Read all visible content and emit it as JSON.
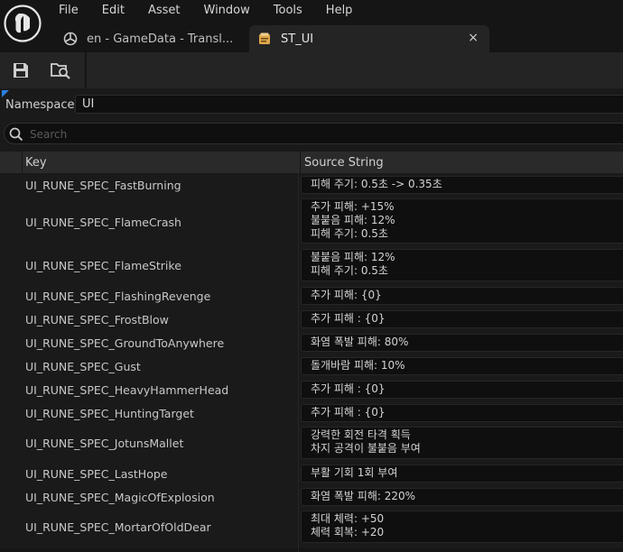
{
  "menu": [
    "File",
    "Edit",
    "Asset",
    "Window",
    "Tools",
    "Help"
  ],
  "tabs": [
    {
      "label": "en - GameData - Transl..."
    },
    {
      "label": "ST_UI",
      "close": "×"
    }
  ],
  "namespace": {
    "label": "Namespace:",
    "value": "UI"
  },
  "search": {
    "placeholder": "Search"
  },
  "table": {
    "headers": {
      "key": "Key",
      "source": "Source String"
    },
    "rows": [
      {
        "key": "UI_RUNE_SPEC_FastBurning",
        "value": "피해 주기: 0.5초 -> 0.35초"
      },
      {
        "key": "UI_RUNE_SPEC_FlameCrash",
        "value": "추가 피해: +15%\n불붙음 피해: 12%\n피해 주기: 0.5초"
      },
      {
        "key": "UI_RUNE_SPEC_FlameStrike",
        "value": "불붙음 피해: 12%\n피해 주기: 0.5초"
      },
      {
        "key": "UI_RUNE_SPEC_FlashingRevenge",
        "value": "추가 피해: {0}"
      },
      {
        "key": "UI_RUNE_SPEC_FrostBlow",
        "value": "추가 피해 : {0}"
      },
      {
        "key": "UI_RUNE_SPEC_GroundToAnywhere",
        "value": "화염 폭발 피해: 80%"
      },
      {
        "key": "UI_RUNE_SPEC_Gust",
        "value": "돌개바람 피해: 10%"
      },
      {
        "key": "UI_RUNE_SPEC_HeavyHammerHead",
        "value": "추가 피해 : {0}"
      },
      {
        "key": "UI_RUNE_SPEC_HuntingTarget",
        "value": "추가 피해 : {0}"
      },
      {
        "key": "UI_RUNE_SPEC_JotunsMallet",
        "value": "강력한 회전 타격 획득\n차지 공격이 불붙음 부여"
      },
      {
        "key": "UI_RUNE_SPEC_LastHope",
        "value": "부활 기회 1회 부여"
      },
      {
        "key": "UI_RUNE_SPEC_MagicOfExplosion",
        "value": "화염 폭발 피해: 220%"
      },
      {
        "key": "UI_RUNE_SPEC_MortarOfOldDear",
        "value": "최대 체력: +50\n체력 회복: +20"
      }
    ]
  }
}
